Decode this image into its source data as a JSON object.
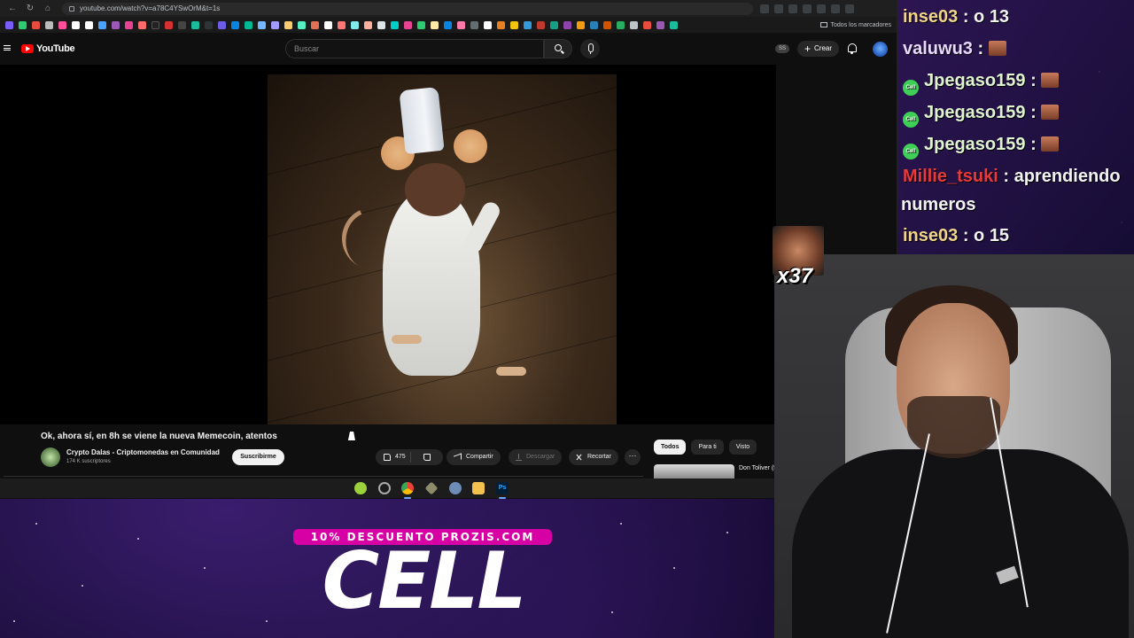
{
  "browser": {
    "url": "youtube.com/watch?v=a78C4YSwOrM&t=1s",
    "bookmarks_all_label": "Todos los marcadores"
  },
  "youtube": {
    "logo_text": "YouTube",
    "search_placeholder": "Buscar",
    "create_label": "Crear",
    "ss_badge": "SS",
    "video": {
      "title": "Ok, ahora sí, en 8h se viene la nueva Memecoin, atentos",
      "channel_name": "Crypto Dalas - Criptomonedas en Comunidad",
      "subscribers": "174 K suscriptores",
      "subscribe_label": "Suscribirme",
      "likes": "475",
      "share_label": "Compartir",
      "download_label": "Descargar",
      "clip_label": "Recortar",
      "more_label": "···"
    },
    "chips": [
      "Todos",
      "Para ti",
      "Visto"
    ],
    "recommendation": {
      "title": "Don Toliver (feat. Doja C"
    }
  },
  "chat": {
    "messages": [
      {
        "user": "inse03",
        "text": " : o 13",
        "color": "#f0d58a"
      },
      {
        "user": "valuwu3",
        "text": " : ",
        "emote": true,
        "color": "#e9d8ff"
      },
      {
        "user": "Jpegaso159",
        "text": " : ",
        "emote": true,
        "badge": true,
        "color": "#dff3d0"
      },
      {
        "user": "Jpegaso159",
        "text": " : ",
        "emote": true,
        "badge": true,
        "color": "#dff3d0"
      },
      {
        "user": "Jpegaso159",
        "text": " : ",
        "emote": true,
        "badge": true,
        "color": "#dff3d0"
      },
      {
        "user": "Millie_tsuki",
        "text": " : aprendiendo",
        "color": "#e83a3a"
      },
      {
        "user": "",
        "text": "numeros",
        "color": "#f2f2f2"
      },
      {
        "user": "inse03",
        "text": " : o 15",
        "color": "#f0d58a"
      }
    ],
    "badge_text": "Cell"
  },
  "overlay": {
    "emote_count": "x37",
    "promo_tag": "10% DESCUENTO PROZIS.COM",
    "promo_big": "CELL"
  },
  "colors": {
    "youtube_red": "#ff0000",
    "promo_magenta": "#d600a4",
    "chat_badge_green": "#3ecf56"
  }
}
